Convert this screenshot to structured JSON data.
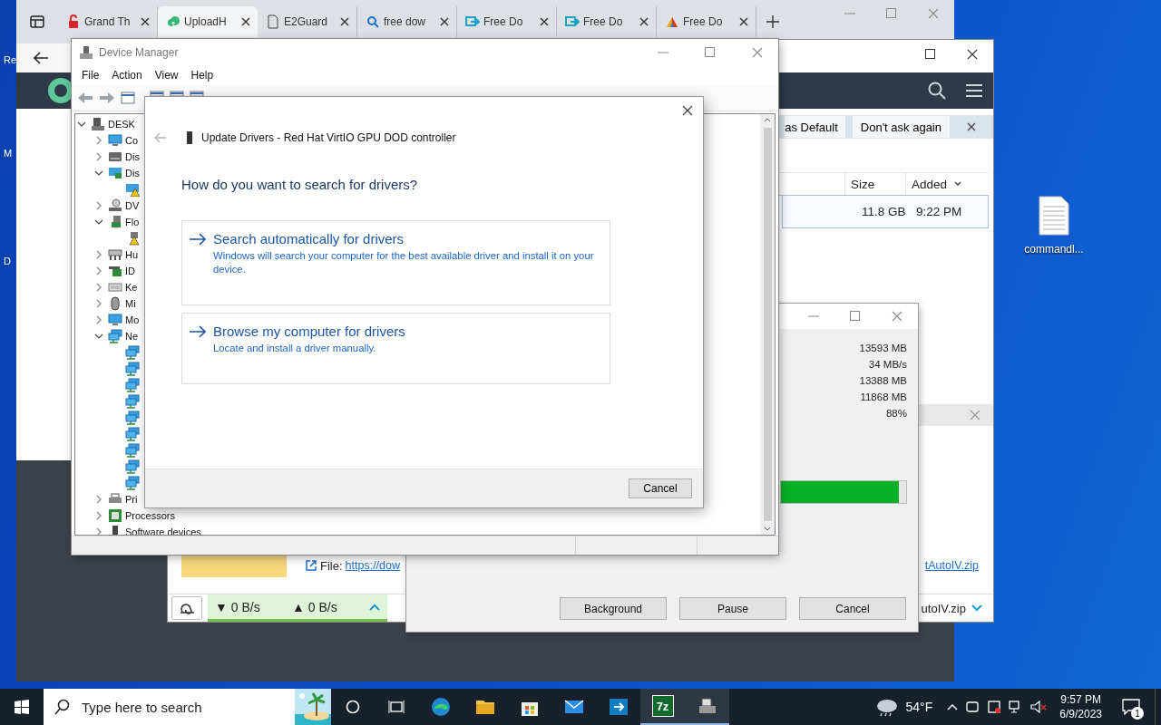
{
  "desktop": {
    "edge_labels": [
      "Re",
      "M",
      "D"
    ],
    "icons": [
      {
        "label": "commandl..."
      }
    ]
  },
  "browser": {
    "tabs": [
      {
        "label": "Grand Th",
        "kind": "lock",
        "selected": false
      },
      {
        "label": "UploadH",
        "kind": "cloud",
        "selected": true
      },
      {
        "label": "E2Guard",
        "kind": "page",
        "selected": false
      },
      {
        "label": "free dow",
        "kind": "search",
        "selected": false
      },
      {
        "label": "Free Do",
        "kind": "download",
        "selected": false
      },
      {
        "label": "Free Do",
        "kind": "download",
        "selected": false
      },
      {
        "label": "Free Do",
        "kind": "colorful",
        "selected": false
      }
    ]
  },
  "uploader": {
    "infobar": {
      "buttons": [
        "as Default",
        "Don't ask again"
      ]
    },
    "table": {
      "columns": [
        {
          "label": "Size",
          "sorted": false
        },
        {
          "label": "Added",
          "sorted": true
        }
      ],
      "rows": [
        {
          "cells": [
            "11.8 GB",
            "9:22 PM"
          ],
          "selected": true
        }
      ]
    },
    "file": {
      "label": "File:",
      "link": "https://dow",
      "name": "tAutoIV.zip"
    },
    "status": {
      "down": "▼ 0 B/s",
      "up": "▲ 0 B/s",
      "file": "utoIV.zip"
    }
  },
  "zip": {
    "values": [
      "13593 MB",
      "34 MB/s",
      "13388 MB",
      "11868 MB",
      "88%"
    ],
    "level": 0.94,
    "buttons": [
      "Background",
      "Pause",
      "Cancel"
    ]
  },
  "device_manager": {
    "title": "Device Manager",
    "menu": [
      "File",
      "Action",
      "View",
      "Help"
    ],
    "tree": [
      {
        "label": "DESK",
        "kind": "computer",
        "expanded": true,
        "children": [
          {
            "label": "Co",
            "kind": "monitor",
            "expanded": false
          },
          {
            "label": "Dis",
            "kind": "disk",
            "expanded": false
          },
          {
            "label": "Dis",
            "kind": "display",
            "expanded": true,
            "children": [
              {
                "kind": "display-warning"
              }
            ]
          },
          {
            "label": "DV",
            "kind": "dvd",
            "expanded": false
          },
          {
            "label": "Flo",
            "kind": "floppy",
            "expanded": true,
            "children": [
              {
                "kind": "floppy-warning"
              }
            ]
          },
          {
            "label": "Hu",
            "kind": "hid",
            "expanded": false
          },
          {
            "label": "ID",
            "kind": "ide",
            "expanded": false
          },
          {
            "label": "Ke",
            "kind": "keyboard",
            "expanded": false
          },
          {
            "label": "Mi",
            "kind": "mouse",
            "expanded": false
          },
          {
            "label": "Mo",
            "kind": "monitor",
            "expanded": false
          },
          {
            "label": "Ne",
            "kind": "network",
            "expanded": true,
            "children": [
              {
                "kind": "network"
              },
              {
                "kind": "network"
              },
              {
                "kind": "network"
              },
              {
                "kind": "network"
              },
              {
                "kind": "network"
              },
              {
                "kind": "network"
              },
              {
                "kind": "network"
              },
              {
                "kind": "network"
              },
              {
                "kind": "network"
              }
            ]
          },
          {
            "label": "Pri",
            "kind": "printer",
            "expanded": false
          },
          {
            "label": "Processors",
            "kind": "processor",
            "expanded": false
          },
          {
            "label": "Software devices",
            "kind": "device",
            "expanded": false
          }
        ]
      }
    ]
  },
  "dialog": {
    "title": "Update Drivers - Red Hat VirtIO GPU DOD controller",
    "heading": "How do you want to search for drivers?",
    "options": [
      {
        "title": "Search automatically for drivers",
        "description": "Windows will search your computer for the best available driver and install it on your device."
      },
      {
        "title": "Browse my computer for drivers",
        "description": "Locate and install a driver manually."
      }
    ],
    "buttons": [
      "Cancel"
    ]
  },
  "taskbar": {
    "search": {
      "placeholder": "Type here to search"
    },
    "apps": [
      {
        "kind": "edge",
        "active": false
      },
      {
        "kind": "folder",
        "active": false
      },
      {
        "kind": "store",
        "active": false
      },
      {
        "kind": "mail",
        "active": false
      },
      {
        "kind": "remote",
        "active": false
      },
      {
        "kind": "sevenzip",
        "label": "7z",
        "active": true
      },
      {
        "kind": "devmgr",
        "active": true
      }
    ],
    "weather": "54°F",
    "time": "9:57 PM",
    "date": "6/9/2023",
    "notifications": "1"
  }
}
